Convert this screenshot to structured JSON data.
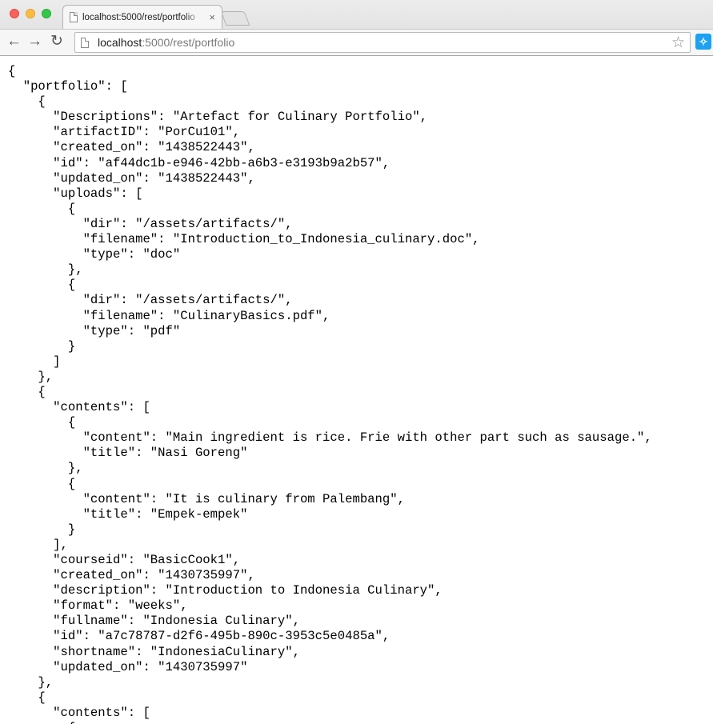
{
  "window": {
    "tab": {
      "title": "localhost:5000/rest/portfolio",
      "close_glyph": "×"
    },
    "address_bar": {
      "host": "localhost",
      "path": ":5000/rest/portfolio"
    },
    "icons": {
      "back": "back-arrow-icon",
      "forward": "forward-arrow-icon",
      "reload": "reload-icon",
      "bookmark": "star-icon",
      "extension": "twitter-extension-icon"
    },
    "colors": {
      "close": "#fc605c",
      "minimize": "#fdbc40",
      "maximize": "#34c84a",
      "extension": "#1da1f2"
    }
  },
  "json_lines": [
    "{",
    "  \"portfolio\": [",
    "    {",
    "      \"Descriptions\": \"Artefact for Culinary Portfolio\",",
    "      \"artifactID\": \"PorCu101\",",
    "      \"created_on\": \"1438522443\",",
    "      \"id\": \"af44dc1b-e946-42bb-a6b3-e3193b9a2b57\",",
    "      \"updated_on\": \"1438522443\",",
    "      \"uploads\": [",
    "        {",
    "          \"dir\": \"/assets/artifacts/\",",
    "          \"filename\": \"Introduction_to_Indonesia_culinary.doc\",",
    "          \"type\": \"doc\"",
    "        },",
    "        {",
    "          \"dir\": \"/assets/artifacts/\",",
    "          \"filename\": \"CulinaryBasics.pdf\",",
    "          \"type\": \"pdf\"",
    "        }",
    "      ]",
    "    },",
    "    {",
    "      \"contents\": [",
    "        {",
    "          \"content\": \"Main ingredient is rice. Frie with other part such as sausage.\",",
    "          \"title\": \"Nasi Goreng\"",
    "        },",
    "        {",
    "          \"content\": \"It is culinary from Palembang\",",
    "          \"title\": \"Empek-empek\"",
    "        }",
    "      ],",
    "      \"courseid\": \"BasicCook1\",",
    "      \"created_on\": \"1430735997\",",
    "      \"description\": \"Introduction to Indonesia Culinary\",",
    "      \"format\": \"weeks\",",
    "      \"fullname\": \"Indonesia Culinary\",",
    "      \"id\": \"a7c78787-d2f6-495b-890c-3953c5e0485a\",",
    "      \"shortname\": \"IndonesiaCulinary\",",
    "      \"updated_on\": \"1430735997\"",
    "    },",
    "    {",
    "      \"contents\": [",
    "        {"
  ]
}
